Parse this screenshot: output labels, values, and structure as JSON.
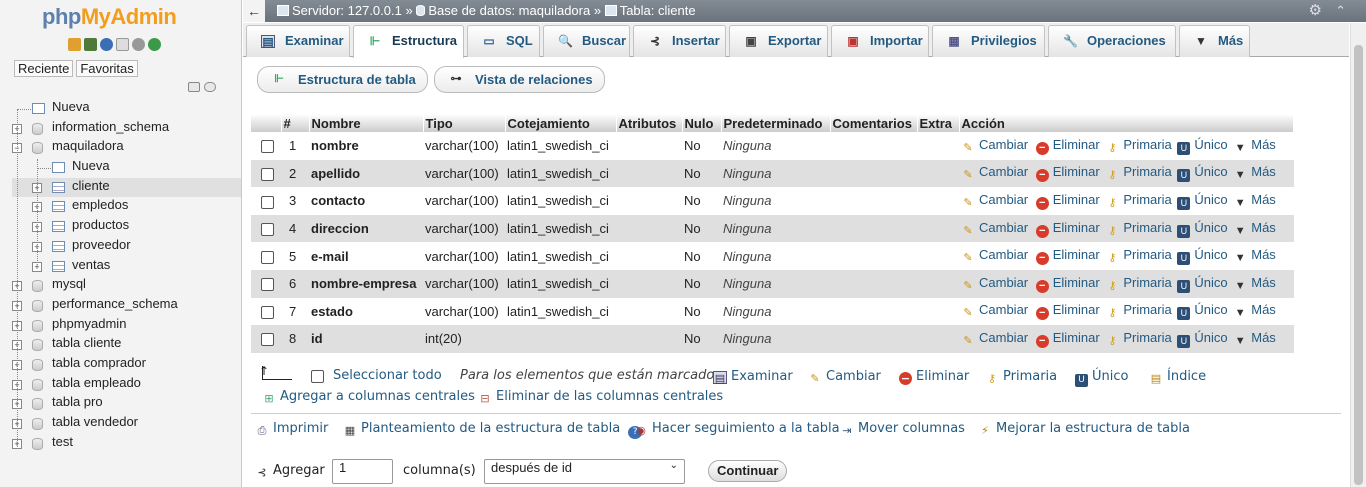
{
  "nav": {
    "logo_php": "php",
    "logo_myadmin": "MyAdmin",
    "recent": "Reciente",
    "favorites": "Favoritas",
    "tree": [
      {
        "label": "Nueva",
        "level": 0,
        "kind": "new"
      },
      {
        "label": "information_schema",
        "level": 0,
        "kind": "db"
      },
      {
        "label": "maquiladora",
        "level": 0,
        "kind": "db",
        "open": true
      },
      {
        "label": "Nueva",
        "level": 1,
        "kind": "new"
      },
      {
        "label": "cliente",
        "level": 1,
        "kind": "table",
        "selected": true
      },
      {
        "label": "empledos",
        "level": 1,
        "kind": "table"
      },
      {
        "label": "productos",
        "level": 1,
        "kind": "table"
      },
      {
        "label": "proveedor",
        "level": 1,
        "kind": "table"
      },
      {
        "label": "ventas",
        "level": 1,
        "kind": "table"
      },
      {
        "label": "mysql",
        "level": 0,
        "kind": "db"
      },
      {
        "label": "performance_schema",
        "level": 0,
        "kind": "db"
      },
      {
        "label": "phpmyadmin",
        "level": 0,
        "kind": "db"
      },
      {
        "label": "tabla cliente",
        "level": 0,
        "kind": "db"
      },
      {
        "label": "tabla comprador",
        "level": 0,
        "kind": "db"
      },
      {
        "label": "tabla empleado",
        "level": 0,
        "kind": "db"
      },
      {
        "label": "tabla pro",
        "level": 0,
        "kind": "db"
      },
      {
        "label": "tabla vendedor",
        "level": 0,
        "kind": "db"
      },
      {
        "label": "test",
        "level": 0,
        "kind": "db"
      }
    ]
  },
  "breadcrumb": {
    "server": "Servidor: 127.0.0.1",
    "database": "Base de datos: maquiladora",
    "table": "Tabla: cliente"
  },
  "tabs": [
    "Examinar",
    "Estructura",
    "SQL",
    "Buscar",
    "Insertar",
    "Exportar",
    "Importar",
    "Privilegios",
    "Operaciones",
    "Más"
  ],
  "active_tab": "Estructura",
  "subtabs": {
    "structure": "Estructura de tabla",
    "relations": "Vista de relaciones"
  },
  "table": {
    "headers": [
      "#",
      "Nombre",
      "Tipo",
      "Cotejamiento",
      "Atributos",
      "Nulo",
      "Predeterminado",
      "Comentarios",
      "Extra",
      "Acción"
    ],
    "rows": [
      {
        "n": "1",
        "name": "nombre",
        "type": "varchar(100)",
        "collation": "latin1_swedish_ci",
        "null": "No",
        "default": "Ninguna"
      },
      {
        "n": "2",
        "name": "apellido",
        "type": "varchar(100)",
        "collation": "latin1_swedish_ci",
        "null": "No",
        "default": "Ninguna"
      },
      {
        "n": "3",
        "name": "contacto",
        "type": "varchar(100)",
        "collation": "latin1_swedish_ci",
        "null": "No",
        "default": "Ninguna"
      },
      {
        "n": "4",
        "name": "direccion",
        "type": "varchar(100)",
        "collation": "latin1_swedish_ci",
        "null": "No",
        "default": "Ninguna"
      },
      {
        "n": "5",
        "name": "e-mail",
        "type": "varchar(100)",
        "collation": "latin1_swedish_ci",
        "null": "No",
        "default": "Ninguna"
      },
      {
        "n": "6",
        "name": "nombre-empresa",
        "type": "varchar(100)",
        "collation": "latin1_swedish_ci",
        "null": "No",
        "default": "Ninguna"
      },
      {
        "n": "7",
        "name": "estado",
        "type": "varchar(100)",
        "collation": "latin1_swedish_ci",
        "null": "No",
        "default": "Ninguna"
      },
      {
        "n": "8",
        "name": "id",
        "type": "int(20)",
        "collation": "",
        "null": "No",
        "default": "Ninguna"
      }
    ],
    "actions": {
      "change": "Cambiar",
      "drop": "Eliminar",
      "primary": "Primaria",
      "unique": "Único",
      "more": "Más"
    }
  },
  "bulk": {
    "select_all": "Seleccionar todo",
    "with_selected": "Para los elementos que están marcados:",
    "browse": "Examinar",
    "change": "Cambiar",
    "drop": "Eliminar",
    "primary": "Primaria",
    "unique": "Único",
    "index": "Índice",
    "add_central": "Agregar a columnas centrales",
    "remove_central": "Eliminar de las columnas centrales"
  },
  "links": {
    "print": "Imprimir",
    "propose": "Planteamiento de la estructura de tabla",
    "track": "Hacer seguimiento a la tabla",
    "move": "Mover columnas",
    "improve": "Mejorar la estructura de tabla"
  },
  "add_columns": {
    "label": "Agregar",
    "count": "1",
    "unit": "columna(s)",
    "position": "después de id",
    "go": "Continuar"
  }
}
